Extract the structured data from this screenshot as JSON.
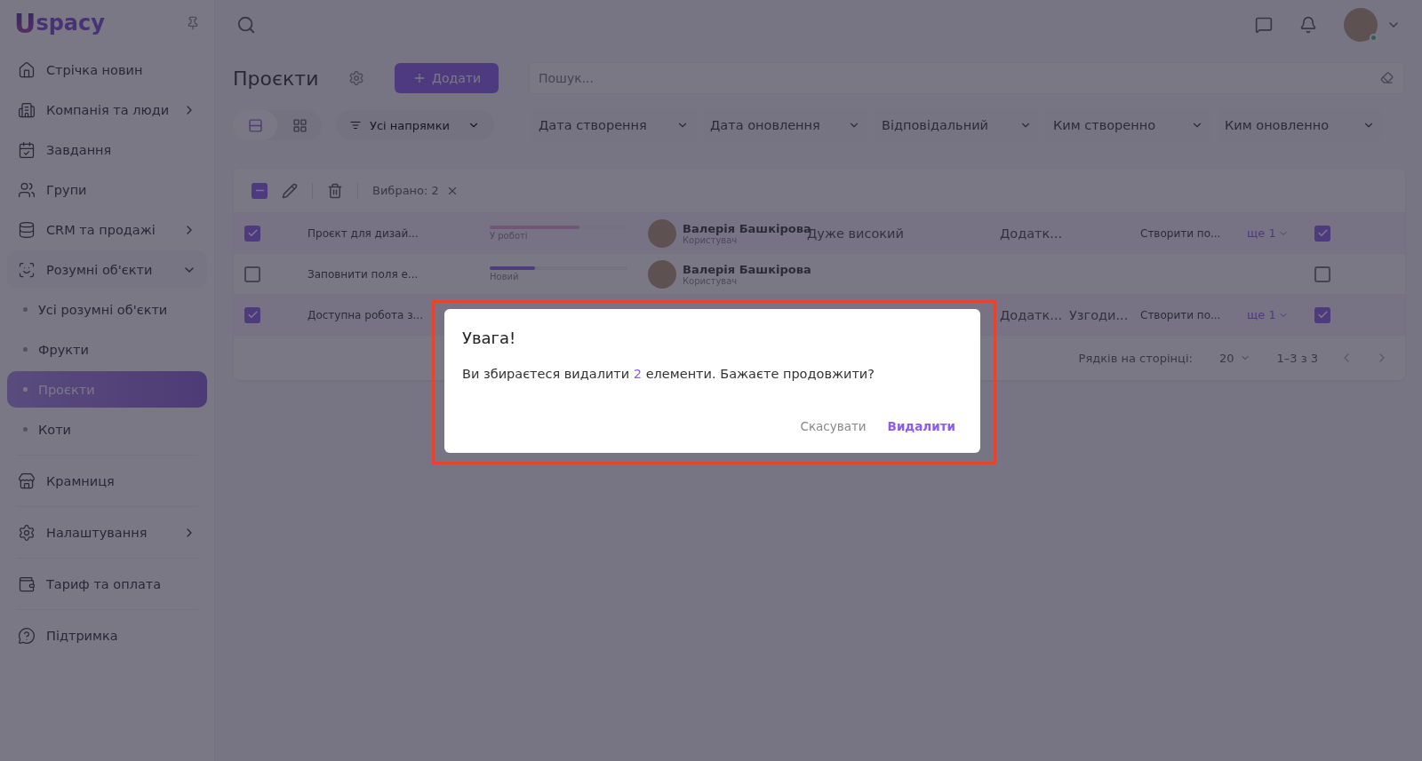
{
  "sidebar": {
    "logo": {
      "mark": "U",
      "text": "spacy"
    },
    "items": [
      {
        "label": "Стрічка новин",
        "selected": false
      },
      {
        "label": "Компанія та люди",
        "selected": false,
        "expanded": false
      },
      {
        "label": "Завдання",
        "selected": false
      },
      {
        "label": "Групи",
        "selected": false
      },
      {
        "label": "CRM та продажі",
        "selected": false,
        "expanded": false
      },
      {
        "label": "Розумні об'єкти",
        "selected": false,
        "expanded": true,
        "children": [
          {
            "label": "Усі розумні об'єкти",
            "selected": false
          },
          {
            "label": "Фрукти",
            "selected": false
          },
          {
            "label": "Проєкти",
            "selected": true
          },
          {
            "label": "Коти",
            "selected": false
          }
        ]
      },
      {
        "label": "Крамниця",
        "selected": false
      },
      {
        "label": "Налаштування",
        "selected": false,
        "expanded": false
      },
      {
        "label": "Тариф та оплата",
        "selected": false
      },
      {
        "label": "Підтримка",
        "selected": false
      }
    ]
  },
  "header": {
    "title": "Проєкти",
    "add_button": "Додати",
    "search": {
      "placeholder": "Пошук..."
    }
  },
  "views": [
    {
      "selected": true
    },
    {
      "selected": false
    }
  ],
  "direction_select": "Усі напрямки",
  "filters": [
    "Дата створення",
    "Дата оновлення",
    "Відповідальний",
    "Ким створенно",
    "Ким оновленно"
  ],
  "table": {
    "select_all": {
      "checked": true,
      "partial": true
    },
    "selected_count": "Вибрано: 2",
    "rows": [
      {
        "checked": true,
        "name": "Проєкт для дизай...",
        "status": {
          "label": "У роботі",
          "level": 0.65,
          "kind": "in_progress"
        },
        "user": {
          "name": "Валерія Башкірова",
          "role": "Користувач"
        },
        "priority": "Дуже високий",
        "column_7": "Додатк...",
        "column_9": "Створити по...",
        "more": "ще 1",
        "flag": true
      },
      {
        "checked": false,
        "name": "Заповнити поля е...",
        "status": {
          "label": "Новий",
          "level": 0.33,
          "kind": "new"
        },
        "user": {
          "name": "Валерія Башкірова",
          "role": "Користувач"
        },
        "flag": false
      },
      {
        "checked": true,
        "name": "Доступна робота з...",
        "column_7": "Додатк...",
        "column_8": "Узгоди...",
        "column_9": "Створити по...",
        "more": "ще 1",
        "flag": true
      }
    ],
    "footer": {
      "rows_label": "Рядків на сторінці:",
      "rows_value": "20",
      "range": "1–3 з 3"
    }
  },
  "dialog": {
    "title": "Увага!",
    "message_before": "Ви збираєтеся видалити",
    "count": "2",
    "message_after": "елементи. Бажаєте продовжити?",
    "cancel": "Скасувати",
    "confirm": "Видалити"
  }
}
